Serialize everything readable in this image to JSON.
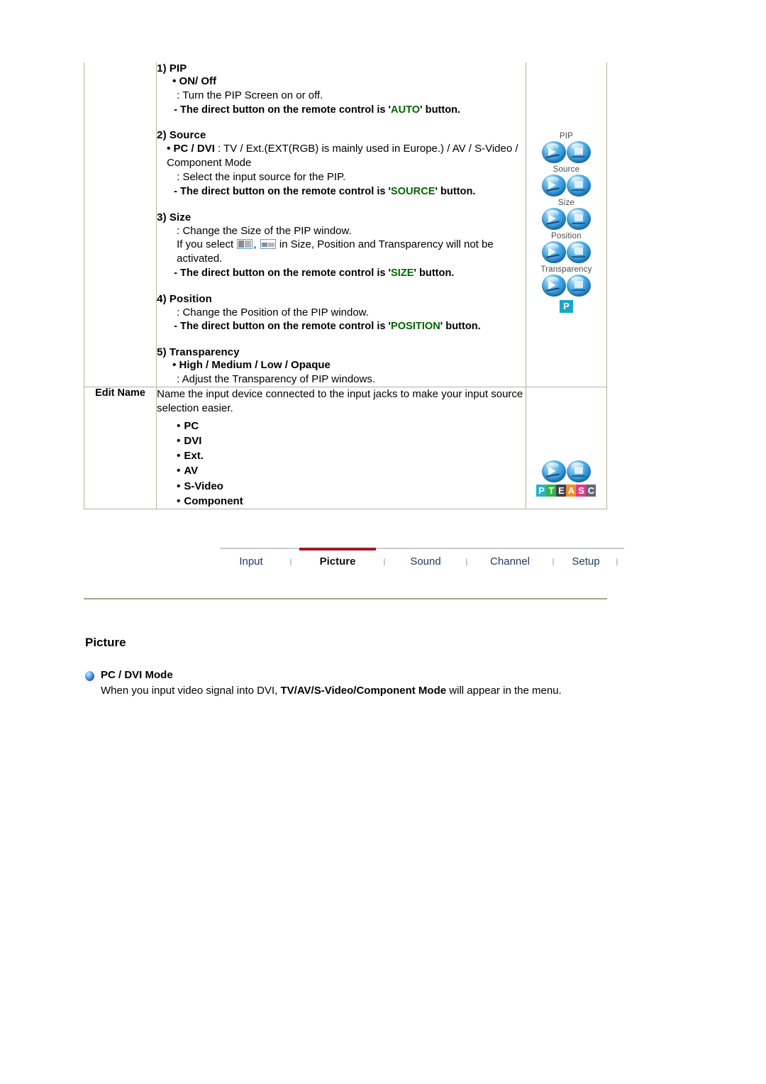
{
  "spec_table": {
    "rows": [
      {
        "label": "",
        "items": [
          {
            "heading": "1) PIP",
            "sub": "• ON/ Off",
            "desc": ": Turn the PIP Screen on or off.",
            "note_pre": "- The direct button on the remote control is '",
            "note_kw": "AUTO",
            "note_post": "' button."
          },
          {
            "heading": "2) Source",
            "sub_b": "• PC / DVI",
            "sub_rest": " : TV / Ext.(EXT(RGB) is mainly used in Europe.) / AV / S-Video / Component Mode",
            "desc": ": Select the input source for the PIP.",
            "note_pre": "- The direct button on the remote control is '",
            "note_kw": "SOURCE",
            "note_post": "' button."
          },
          {
            "heading": "3) Size",
            "desc": ": Change the Size of the PIP window.",
            "desc2_pre": "If you select ",
            "desc2_mid": ", ",
            "desc2_post": " in Size, Position and Transparency will not be activated.",
            "note_pre": "- The direct button on the remote control is '",
            "note_kw": "SIZE",
            "note_post": "' button."
          },
          {
            "heading": "4) Position",
            "desc": ": Change the Position of the PIP window.",
            "note_pre": "- The direct button on the remote control is '",
            "note_kw": "POSITION",
            "note_post": "' button."
          },
          {
            "heading": "5) Transparency",
            "sub": "• High / Medium / Low / Opaque",
            "desc": ": Adjust the Transparency of PIP windows."
          }
        ],
        "icons": {
          "groups": [
            {
              "caption": "PIP"
            },
            {
              "caption": "Source"
            },
            {
              "caption": "Size"
            },
            {
              "caption": "Position"
            },
            {
              "caption": "Transparency"
            }
          ],
          "badge": "P"
        }
      },
      {
        "label": "Edit Name",
        "intro": "Name the input device connected to the input jacks to make your input source selection easier.",
        "list": [
          "PC",
          "DVI",
          "Ext.",
          "AV",
          "S-Video",
          "Component"
        ],
        "icons": {
          "pteasc": [
            {
              "letter": "P",
              "color": "#2bb3c9"
            },
            {
              "letter": "T",
              "color": "#34b34a"
            },
            {
              "letter": "E",
              "color": "#44404f"
            },
            {
              "letter": "A",
              "color": "#f29029"
            },
            {
              "letter": "S",
              "color": "#e8398f"
            },
            {
              "letter": "C",
              "color": "#6a5f78"
            }
          ]
        }
      }
    ]
  },
  "tabnav": {
    "tabs": [
      {
        "label": "Input",
        "active": false
      },
      {
        "label": "Picture",
        "active": true
      },
      {
        "label": "Sound",
        "active": false
      },
      {
        "label": "Channel",
        "active": false
      },
      {
        "label": "Setup",
        "active": false
      }
    ],
    "separator": "l",
    "active_color": "#9e1b27"
  },
  "lower": {
    "section_title": "Picture",
    "bullet_title": "PC / DVI Mode",
    "bullet_sub_pre": "When you input video signal into DVI, ",
    "bullet_sub_bold": "TV/AV/S-Video/Component Mode",
    "bullet_sub_post": " will appear in the menu."
  }
}
